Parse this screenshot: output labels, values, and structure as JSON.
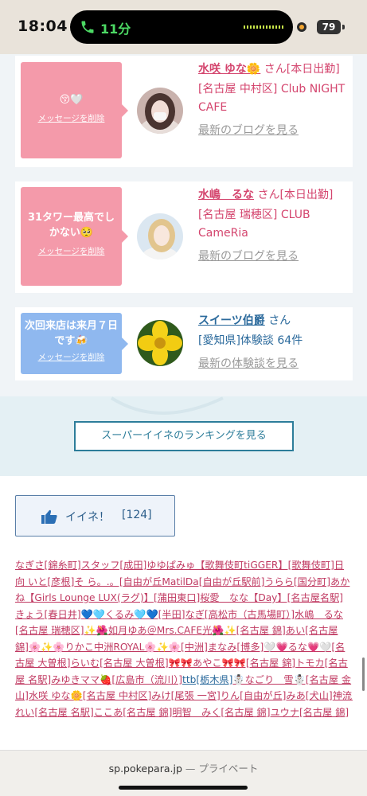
{
  "status_bar": {
    "time": "18:04",
    "call": "11分",
    "battery": "79"
  },
  "cards": [
    {
      "message": "😚🤍",
      "delete": "メッセージを削除",
      "name": "水咲 ゆな🌼",
      "san": "さん",
      "tag": "[本日出勤]",
      "area": "[名古屋 中村区] Club NIGHT CAFE",
      "more": "最新のブログを見る"
    },
    {
      "message": "31タワー最高でしかない🥺",
      "delete": "メッセージを削除",
      "name": "水嶋　るな",
      "san": "さん",
      "tag": "[本日出勤]",
      "area": "[名古屋 瑞穂区] CLUB CameRia",
      "more": "最新のブログを見る"
    },
    {
      "message": "次回来店は来月７日です🍻",
      "delete": "メッセージを削除",
      "name": "スイーツ伯爵",
      "san": "さん",
      "area": "[愛知県]体験談 64件",
      "more": "最新の体験談を見る"
    }
  ],
  "ranking_button": "スーパーイイネのランキングを見る",
  "like": {
    "label": "イイネ！",
    "count": "[124]"
  },
  "names_list": [
    "なぎさ[錦糸町]",
    "スタッフ[成田]",
    "ゆゆぱみゅ【歌舞伎町tiGGER】[歌舞伎町]",
    "日向 いと[彦根]",
    "そ ら。.。[自由が丘MatilDa[自由が丘駅前]",
    "うらら[国分町]",
    "あかね【Girls Lounge LUX(ラグ)】[蒲田東口]",
    "桜愛　なな【Day】[名古屋名駅]",
    "きょう[春日井]",
    "💙🩵くるみ🩵💙[半田]",
    "なぎ[高松市（古馬場町）]",
    "水嶋　るな[名古屋 瑞穂区]",
    "✨🌺如月ゆあ＠Mrs.CAFE光🌺✨[名古屋 錦]",
    "あい[名古屋 錦]",
    "🌸✨🌸りかこ中洲ROYAL🌸✨🌸[中洲]",
    "まなみ[博多]",
    "🤍💗るな💗🤍[名古屋 大曽根]",
    "らいむ[名古屋 大曽根]",
    "🎀🎀あやこ🎀🎀[名古屋 錦]",
    "トモカ[名古屋 名駅]",
    "みゆきママ🍓[広島市（流川）]",
    "ttb[栃木県]",
    "☃️なごり　雪☃️[名古屋 金山]",
    "水咲 ゆな🌼[名古屋 中村区]",
    "みけ[尾張 一宮]",
    "りん[自由が丘]",
    "みあ[犬山]",
    "神流　れい[名古屋 名駅]",
    "ここあ[名古屋 錦]",
    "明智　みく[名古屋 錦]",
    "ユウナ[名古屋 錦]"
  ],
  "url_bar": {
    "domain": "sp.pokepara.jp",
    "separator": " — ",
    "mode": "プライベート"
  }
}
